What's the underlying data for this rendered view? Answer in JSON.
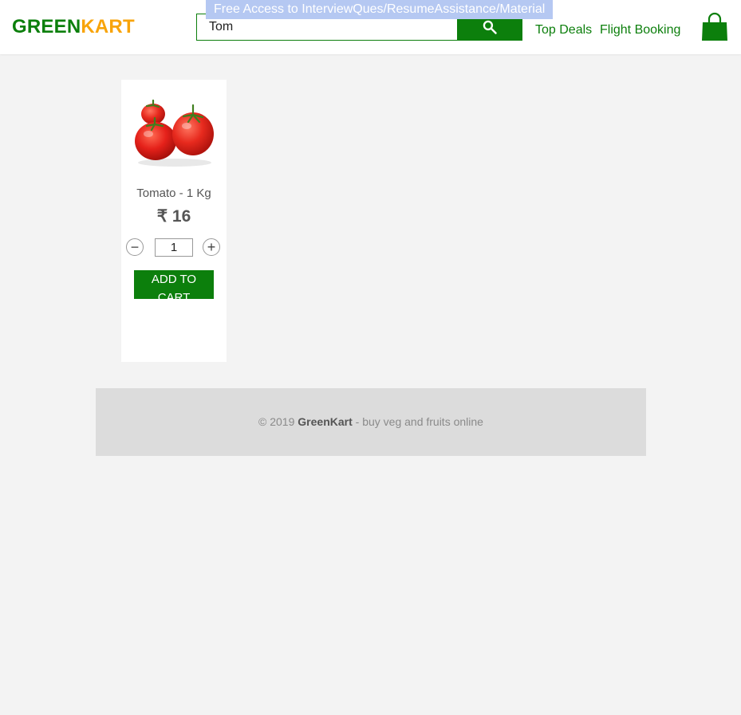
{
  "header": {
    "brand_part1": "GREEN",
    "brand_part2": "KART",
    "promo_text": "Free Access to InterviewQues/ResumeAssistance/Material",
    "search": {
      "value": "Tom",
      "icon": "search-icon"
    },
    "nav": {
      "top_deals": "Top Deals",
      "flight_booking": "Flight Booking"
    },
    "cart_icon": "shopping-bag-icon"
  },
  "products": [
    {
      "name": "Tomato - 1 Kg",
      "price": "₹ 16",
      "quantity": "1",
      "decrement_label": "−",
      "increment_label": "+",
      "add_label": "ADD TO CART",
      "image_icon": "tomato-image"
    }
  ],
  "footer": {
    "copyright": "© 2019 ",
    "brand": "GreenKart",
    "tagline": " - buy veg and fruits online"
  },
  "colors": {
    "brand_green": "#0c7f0c",
    "brand_orange": "#f8a40a",
    "promo_bg": "#b5c8f2",
    "page_bg": "#f3f3f3",
    "footer_bg": "#dcdcdc"
  }
}
